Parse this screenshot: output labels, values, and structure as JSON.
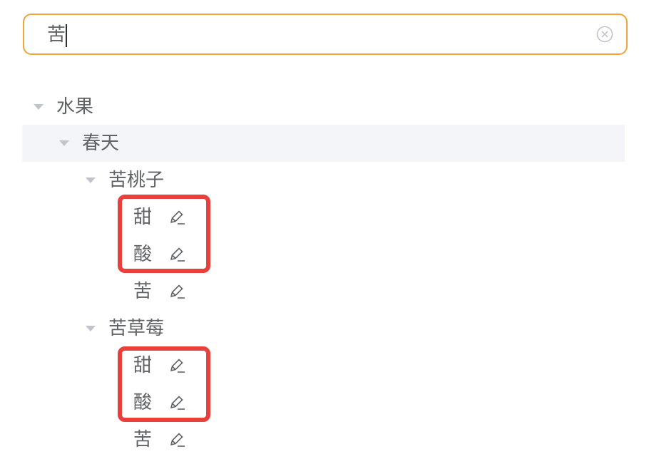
{
  "search": {
    "value": "苦"
  },
  "tree": {
    "root_label": "水果",
    "season_label": "春天",
    "group1": {
      "label": "苦桃子",
      "leaves": [
        "甜",
        "酸",
        "苦"
      ]
    },
    "group2": {
      "label": "苦草莓",
      "leaves": [
        "甜",
        "酸",
        "苦"
      ]
    }
  },
  "colors": {
    "search_border": "#f0a23b",
    "highlight_row": "#f3f5f8",
    "annotation_box": "#e8403d",
    "text": "#606266"
  }
}
